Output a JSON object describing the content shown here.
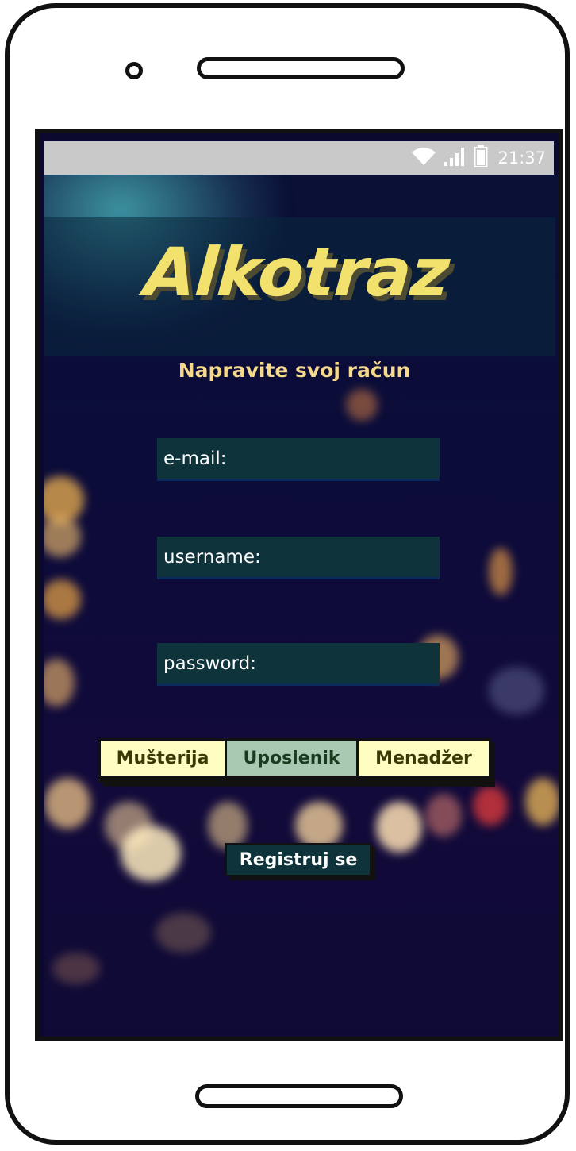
{
  "status_bar": {
    "time": "21:37",
    "icons": [
      "wifi-icon",
      "signal-icon",
      "battery-icon"
    ]
  },
  "app": {
    "title": "Alkotraz",
    "subtitle": "Napravite svoj račun"
  },
  "form": {
    "email_label": "e-mail:",
    "username_label": "username:",
    "password_label": "password:"
  },
  "role_selector": {
    "options": [
      "Mušterija",
      "Uposlenik",
      "Menadžer"
    ],
    "selected": "Uposlenik"
  },
  "actions": {
    "register_label": "Registruj se"
  },
  "colors": {
    "accent_yellow": "#f3e16d",
    "field_bg": "#0e333a",
    "selected_segment": "#a9c9b3",
    "segment_bg": "#fffdc2"
  }
}
